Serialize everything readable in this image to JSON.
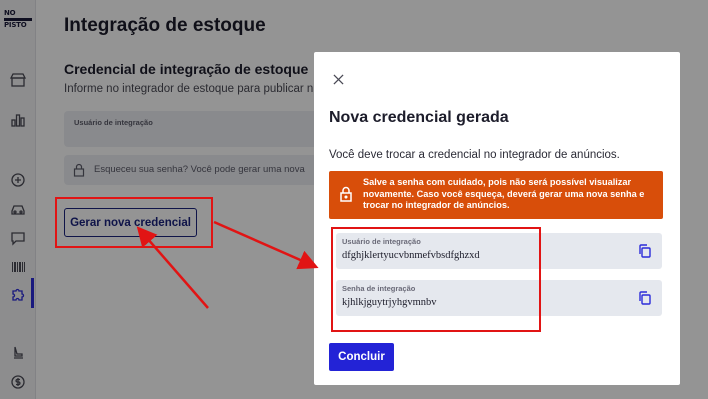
{
  "sidebar": {
    "logo_line1": "NO",
    "logo_line2": "PISTO",
    "items": [
      "store-icon",
      "chart-icon",
      "plus-circle-icon",
      "car-icon",
      "chat-icon",
      "barcode-icon",
      "puzzle-icon",
      "seat-icon",
      "money-icon"
    ]
  },
  "page": {
    "title": "Integração de estoque",
    "section_title": "Credencial de integração de estoque",
    "section_desc": "Informe no integrador de estoque para publicar n",
    "user_field_label": "Usuário de integração",
    "hint_text": "Esqueceu sua senha? Você pode gerar uma nova",
    "generate_button": "Gerar nova credencial"
  },
  "modal": {
    "title": "Nova credencial gerada",
    "description": "Você deve trocar a credencial no integrador de anúncios.",
    "warning": "Salve a senha com cuidado, pois não será possível visualizar novamente. Caso você esqueça, deverá gerar uma nova senha e trocar no integrador de anúncios.",
    "user_label": "Usuário de integração",
    "user_value": "dfghjklertyucvbnmefvbsdfghzxd",
    "password_label": "Senha de integração",
    "password_value": "kjhlkjguytrjyhgvmnbv",
    "confirm_button": "Concluir"
  },
  "colors": {
    "primary": "#2323d6",
    "warning": "#d84e0a",
    "annotation": "#e11414"
  }
}
